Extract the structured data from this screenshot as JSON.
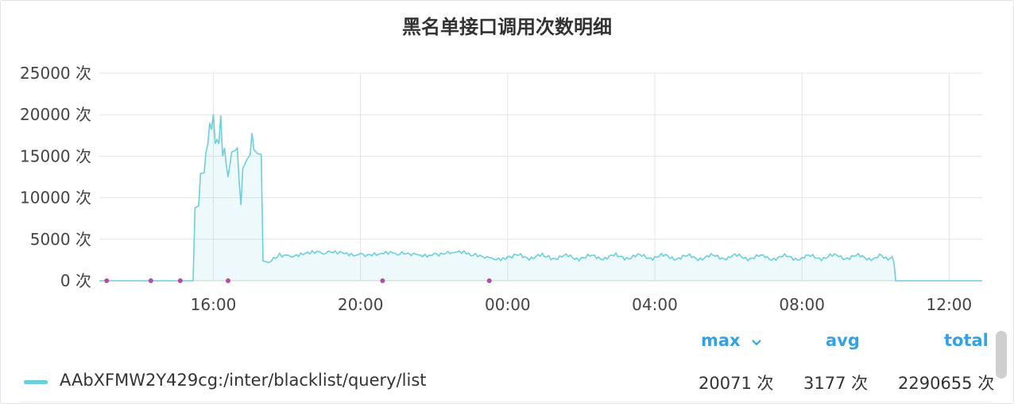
{
  "panel": {
    "title": "黑名单接口调用次数明细"
  },
  "chart_data": {
    "type": "area",
    "title": "黑名单接口调用次数明细",
    "unit": "次",
    "ylim": [
      0,
      25000
    ],
    "yticks": [
      0,
      5000,
      10000,
      15000,
      20000,
      25000
    ],
    "ytick_labels": [
      "0 次",
      "5000 次",
      "10000 次",
      "15000 次",
      "20000 次",
      "25000 次"
    ],
    "xlim_hours": [
      12.9,
      36.9
    ],
    "xticks": [
      {
        "hour": 16,
        "label": "16:00"
      },
      {
        "hour": 20,
        "label": "20:00"
      },
      {
        "hour": 24,
        "label": "00:00"
      },
      {
        "hour": 28,
        "label": "04:00"
      },
      {
        "hour": 32,
        "label": "08:00"
      },
      {
        "hour": 36,
        "label": "12:00"
      }
    ],
    "grid": true,
    "series": [
      {
        "name": "AAbXFMW2Y429cg:/inter/blacklist/query/list",
        "color": "#6ccfdc",
        "points": [
          [
            12.9,
            0
          ],
          [
            15.3,
            0
          ],
          [
            15.45,
            0
          ],
          [
            15.5,
            8800
          ],
          [
            15.6,
            9000
          ],
          [
            15.65,
            12900
          ],
          [
            15.75,
            13000
          ],
          [
            15.8,
            15500
          ],
          [
            15.85,
            16500
          ],
          [
            15.9,
            19000
          ],
          [
            15.95,
            18200
          ],
          [
            16.0,
            20071
          ],
          [
            16.05,
            16500
          ],
          [
            16.1,
            17000
          ],
          [
            16.15,
            16500
          ],
          [
            16.2,
            19900
          ],
          [
            16.25,
            15000
          ],
          [
            16.3,
            16000
          ],
          [
            16.35,
            14000
          ],
          [
            16.4,
            12500
          ],
          [
            16.5,
            15500
          ],
          [
            16.6,
            15700
          ],
          [
            16.65,
            16000
          ],
          [
            16.7,
            12000
          ],
          [
            16.75,
            9100
          ],
          [
            16.8,
            13500
          ],
          [
            16.9,
            14500
          ],
          [
            17.0,
            15200
          ],
          [
            17.05,
            17800
          ],
          [
            17.1,
            15800
          ],
          [
            17.2,
            15300
          ],
          [
            17.3,
            15200
          ],
          [
            17.35,
            2400
          ],
          [
            17.5,
            2200
          ],
          [
            17.7,
            2700
          ],
          [
            17.8,
            3300
          ],
          [
            18.0,
            3100
          ],
          [
            18.5,
            3300
          ],
          [
            19.0,
            3200
          ],
          [
            19.5,
            3400
          ],
          [
            20.0,
            3300
          ],
          [
            20.5,
            3200
          ],
          [
            21.0,
            3100
          ],
          [
            21.5,
            3200
          ],
          [
            22.0,
            3300
          ],
          [
            22.5,
            3400
          ],
          [
            23.0,
            3000
          ],
          [
            23.5,
            2800
          ],
          [
            24.0,
            2900
          ],
          [
            25.0,
            2900
          ],
          [
            26.0,
            2800
          ],
          [
            27.0,
            2900
          ],
          [
            28.0,
            2900
          ],
          [
            29.0,
            2800
          ],
          [
            30.0,
            2900
          ],
          [
            31.0,
            2800
          ],
          [
            32.0,
            2800
          ],
          [
            33.0,
            2900
          ],
          [
            34.0,
            2800
          ],
          [
            34.45,
            2900
          ],
          [
            34.5,
            2200
          ],
          [
            34.55,
            0
          ],
          [
            36.9,
            0
          ]
        ]
      }
    ],
    "annotations": [
      {
        "hour": 13.1,
        "value": 0
      },
      {
        "hour": 14.3,
        "value": 0
      },
      {
        "hour": 16.4,
        "value": 0
      },
      {
        "hour": 20.6,
        "value": 0
      },
      {
        "hour": 23.5,
        "value": 0
      },
      {
        "hour": 15.1,
        "value": 0
      }
    ]
  },
  "legend": {
    "headers": {
      "max": "max",
      "avg": "avg",
      "total": "total"
    },
    "sort_indicator": "chevron-down-icon",
    "series": [
      {
        "name": "AAbXFMW2Y429cg:/inter/blacklist/query/list",
        "max": "20071 次",
        "avg": "3177 次",
        "total": "2290655 次",
        "color": "#6ccfdc"
      }
    ]
  }
}
